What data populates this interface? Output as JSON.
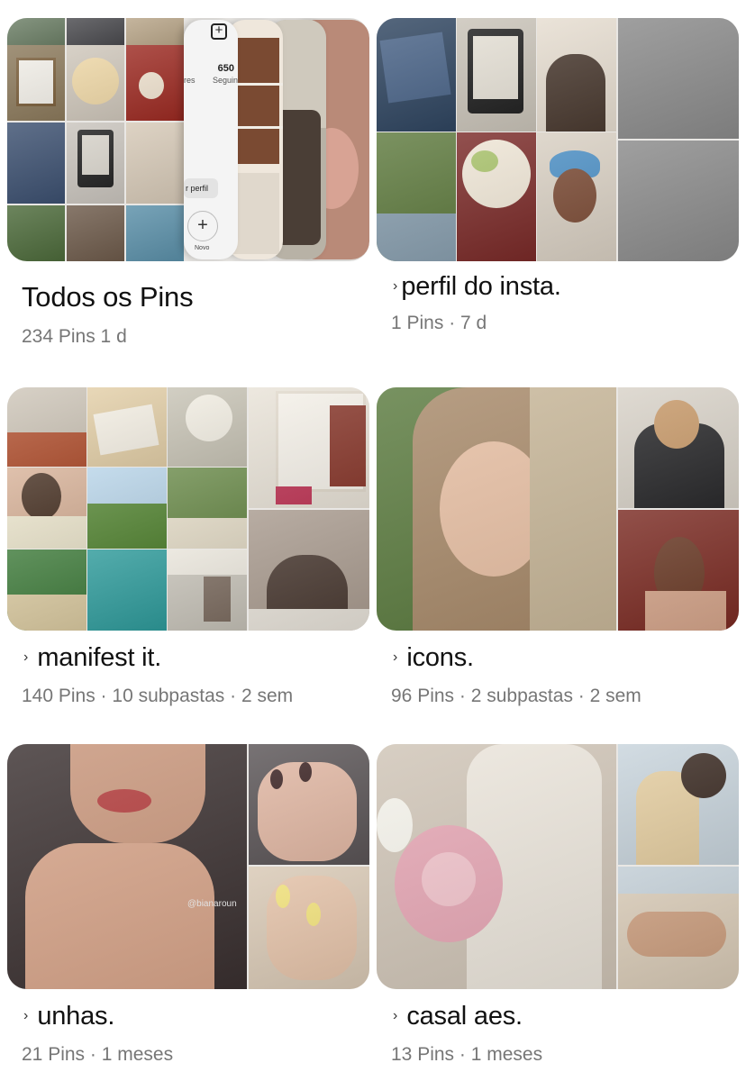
{
  "boards": [
    {
      "id": "todos",
      "title": "Todos os Pins",
      "meta": "234 Pins   1 d",
      "has_chevron": false,
      "profile_preview": {
        "count": "650",
        "followers_suffix": "res",
        "following_label": "Seguin",
        "button_label": "r perfil",
        "new_label": "Novo"
      }
    },
    {
      "id": "perfil",
      "title": "perfil do insta.",
      "meta": "1 Pins · 7 d",
      "has_chevron": true
    },
    {
      "id": "manifest",
      "title": "manifest it.",
      "meta": "140 Pins · 10 subpastas · 2 sem",
      "has_chevron": true
    },
    {
      "id": "icons",
      "title": "icons.",
      "meta": "96 Pins · 2 subpastas · 2 sem",
      "has_chevron": true
    },
    {
      "id": "unhas",
      "title": "unhas.",
      "meta": "21 Pins · 1 meses",
      "has_chevron": true,
      "watermark": "@bianaroun"
    },
    {
      "id": "casal",
      "title": "casal aes.",
      "meta": "13 Pins · 1 meses",
      "has_chevron": true
    }
  ],
  "icons": {
    "chevron": "›",
    "plus": "+"
  },
  "colors": {
    "title": "#111111",
    "meta": "#767676",
    "placeholder": "#8a8a8a",
    "background": "#ffffff"
  }
}
